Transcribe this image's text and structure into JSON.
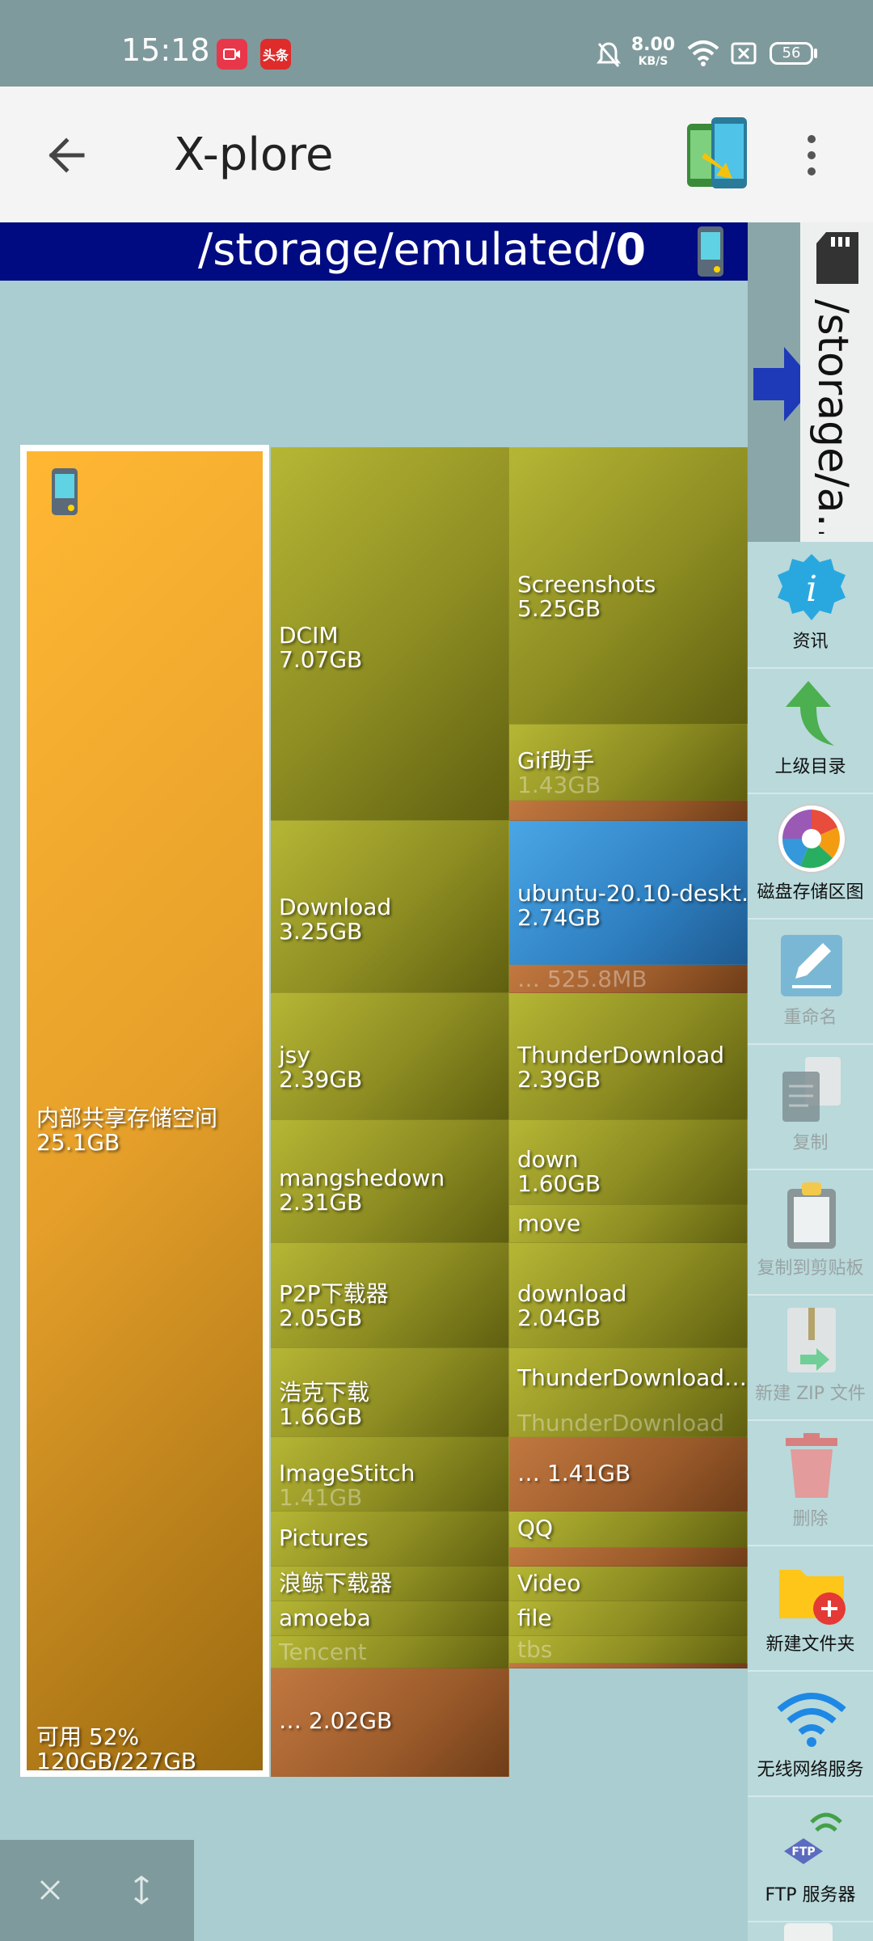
{
  "status_bar": {
    "time": "15:18",
    "badge_news": "头条",
    "net_speed": "8.00",
    "net_unit": "KB/S",
    "battery": "56"
  },
  "app_bar": {
    "title": "X-plore"
  },
  "path_bar": {
    "path_prefix": "/storage/emulated/",
    "path_last": "0"
  },
  "side_pane": {
    "path": "/storage/a…"
  },
  "tools": [
    {
      "label": "资讯",
      "icon": "info-icon",
      "enabled": true
    },
    {
      "label": "上级目录",
      "icon": "up-arrow-icon",
      "enabled": true
    },
    {
      "label": "磁盘存储区图",
      "icon": "disk-map-icon",
      "enabled": true
    },
    {
      "label": "重命名",
      "icon": "rename-icon",
      "enabled": false
    },
    {
      "label": "复制",
      "icon": "copy-icon",
      "enabled": false
    },
    {
      "label": "复制到剪贴板",
      "icon": "clipboard-icon",
      "enabled": false
    },
    {
      "label": "新建 ZIP 文件",
      "icon": "zip-icon",
      "enabled": false
    },
    {
      "label": "删除",
      "icon": "trash-icon",
      "enabled": false
    },
    {
      "label": "新建文件夹",
      "icon": "new-folder-icon",
      "enabled": true
    },
    {
      "label": "无线网络服务",
      "icon": "wifi-icon",
      "enabled": true
    },
    {
      "label": "FTP 服务器",
      "icon": "ftp-icon",
      "enabled": true
    }
  ],
  "ftp_icon_text": "FTP",
  "treemap": {
    "root": {
      "name": "内部共享存储空间",
      "size": "25.1GB",
      "free": "可用 52%",
      "free_detail": "120GB/227GB"
    },
    "folders": [
      {
        "name": "DCIM",
        "size": "7.07GB"
      },
      {
        "name": "Screenshots",
        "size": "5.25GB"
      },
      {
        "name": "Gif助手",
        "size": "1.43GB"
      },
      {
        "name": "Download",
        "size": "3.25GB"
      },
      {
        "name": "ubuntu-20.10-deskt…",
        "size": "2.74GB"
      },
      {
        "name": "…",
        "size": "525.8MB"
      },
      {
        "name": "jsy",
        "size": "2.39GB"
      },
      {
        "name": "ThunderDownload",
        "size": "2.39GB"
      },
      {
        "name": "mangshedown",
        "size": "2.31GB"
      },
      {
        "name": "down",
        "size": "1.60GB"
      },
      {
        "name": "move",
        "size": ""
      },
      {
        "name": "P2P下载器",
        "size": "2.05GB"
      },
      {
        "name": "download",
        "size": "2.04GB"
      },
      {
        "name": "浩克下载",
        "size": "1.66GB"
      },
      {
        "name": "ThunderDownload…",
        "size": ""
      },
      {
        "name": "ThunderDownload",
        "size": ""
      },
      {
        "name": "ImageStitch",
        "size": "1.41GB"
      },
      {
        "name": "…",
        "size": "1.41GB"
      },
      {
        "name": "Pictures",
        "size": ""
      },
      {
        "name": "QQ",
        "size": ""
      },
      {
        "name": "浪鲸下载器",
        "size": ""
      },
      {
        "name": "Video",
        "size": ""
      },
      {
        "name": "amoeba",
        "size": ""
      },
      {
        "name": "file",
        "size": ""
      },
      {
        "name": "Tencent",
        "size": ""
      },
      {
        "name": "tbs",
        "size": ""
      },
      {
        "name": "…",
        "size": "2.02GB"
      }
    ]
  },
  "colors": {
    "status_bar": "#7f9a9c",
    "path_bar": "#000b82",
    "background": "#a9cdd0",
    "root_cell": "#e6a02a"
  }
}
